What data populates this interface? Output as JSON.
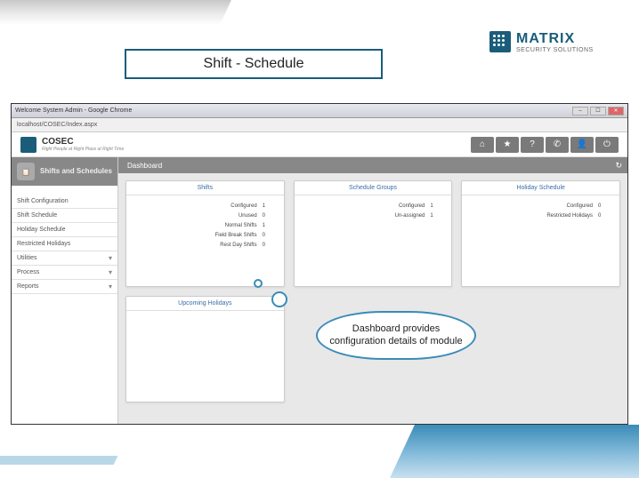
{
  "slide": {
    "title": "Shift - Schedule",
    "logo_main": "MATRIX",
    "logo_sub": "SECURITY SOLUTIONS"
  },
  "chrome": {
    "title": "Welcome System Admin - Google Chrome",
    "url": "localhost/COSEC/Index.aspx"
  },
  "app": {
    "brand_name": "COSEC",
    "brand_tag": "Right People at Right Place at Right Time",
    "brand_logo": "MATRIX"
  },
  "sidebar": {
    "header_label": "Shifts and Schedules",
    "items": [
      {
        "label": "Shift Configuration",
        "expandable": false
      },
      {
        "label": "Shift Schedule",
        "expandable": false
      },
      {
        "label": "Holiday Schedule",
        "expandable": false
      },
      {
        "label": "Restricted Holidays",
        "expandable": false
      },
      {
        "label": "Utilities",
        "expandable": true
      },
      {
        "label": "Process",
        "expandable": true
      },
      {
        "label": "Reports",
        "expandable": true
      }
    ]
  },
  "content": {
    "tab": "Dashboard"
  },
  "cards": {
    "shifts": {
      "title": "Shifts",
      "rows": [
        {
          "label": "Configured",
          "value": "1"
        },
        {
          "label": "Unused",
          "value": "0"
        },
        {
          "label": "Normal Shifts",
          "value": "1"
        },
        {
          "label": "Field Break Shifts",
          "value": "0"
        },
        {
          "label": "Rest Day Shifts",
          "value": "0"
        }
      ]
    },
    "schedule_groups": {
      "title": "Schedule Groups",
      "rows": [
        {
          "label": "Configured",
          "value": "1"
        },
        {
          "label": "Un-assigned",
          "value": "1"
        }
      ]
    },
    "holiday_schedule": {
      "title": "Holiday Schedule",
      "rows": [
        {
          "label": "Configured",
          "value": "0"
        },
        {
          "label": "Restricted Holidays",
          "value": "0"
        }
      ]
    },
    "upcoming": {
      "title": "Upcoming Holidays"
    }
  },
  "callout": {
    "text": "Dashboard provides configuration details of module"
  }
}
